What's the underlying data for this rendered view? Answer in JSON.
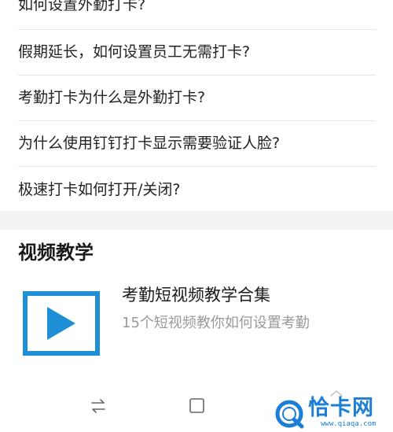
{
  "faq": {
    "items": [
      "如何设置外勤打卡?",
      "假期延长，如何设置员工无需打卡?",
      "考勤打卡为什么是外勤打卡?",
      "为什么使用钉钉打卡显示需要验证人脸?",
      "极速打卡如何打开/关闭?"
    ]
  },
  "video_section": {
    "title": "视频教学",
    "card": {
      "title": "考勤短视频教学合集",
      "subtitle": "15个短视频教你如何设置考勤"
    }
  },
  "navbar": {
    "icons": [
      "swap-icon",
      "home-square-icon",
      "back-chevron-icon"
    ]
  },
  "watermark": {
    "text": "恰卡网",
    "url": "www.qiaqa.com"
  },
  "colors": {
    "accent": "#1e8fd6",
    "divider": "#e6e6e6",
    "section_gap": "#f3f3f3",
    "subtitle": "#9a9a9a"
  }
}
